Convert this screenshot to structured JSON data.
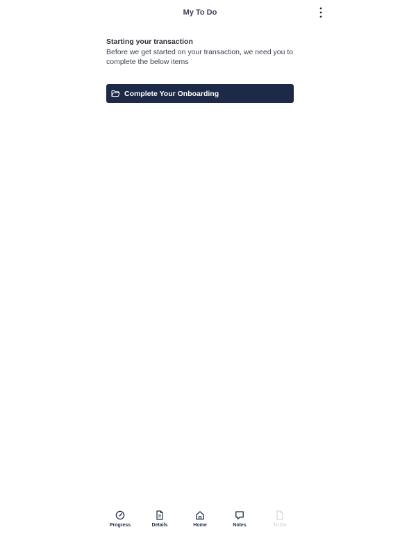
{
  "header": {
    "title": "My To Do",
    "menu_icon": "more-vertical-icon"
  },
  "intro": {
    "title": "Starting your transaction",
    "body": "Before we get started on your transaction, we need you to complete the below items"
  },
  "todo_items": [
    {
      "label": "Complete Your Onboarding",
      "icon": "folder-open-icon"
    }
  ],
  "tabbar": {
    "tabs": [
      {
        "label": "Progress",
        "icon": "gauge-icon",
        "active": true
      },
      {
        "label": "Details",
        "icon": "document-icon",
        "active": true
      },
      {
        "label": "Home",
        "icon": "home-icon",
        "active": true
      },
      {
        "label": "Notes",
        "icon": "chat-bubble-icon",
        "active": true
      },
      {
        "label": "To Do",
        "icon": "document-icon",
        "active": false
      }
    ]
  },
  "colors": {
    "primary": "#1c2a48",
    "text": "#2a2f3a",
    "disabled": "#d4d7dd",
    "background": "#ffffff"
  }
}
